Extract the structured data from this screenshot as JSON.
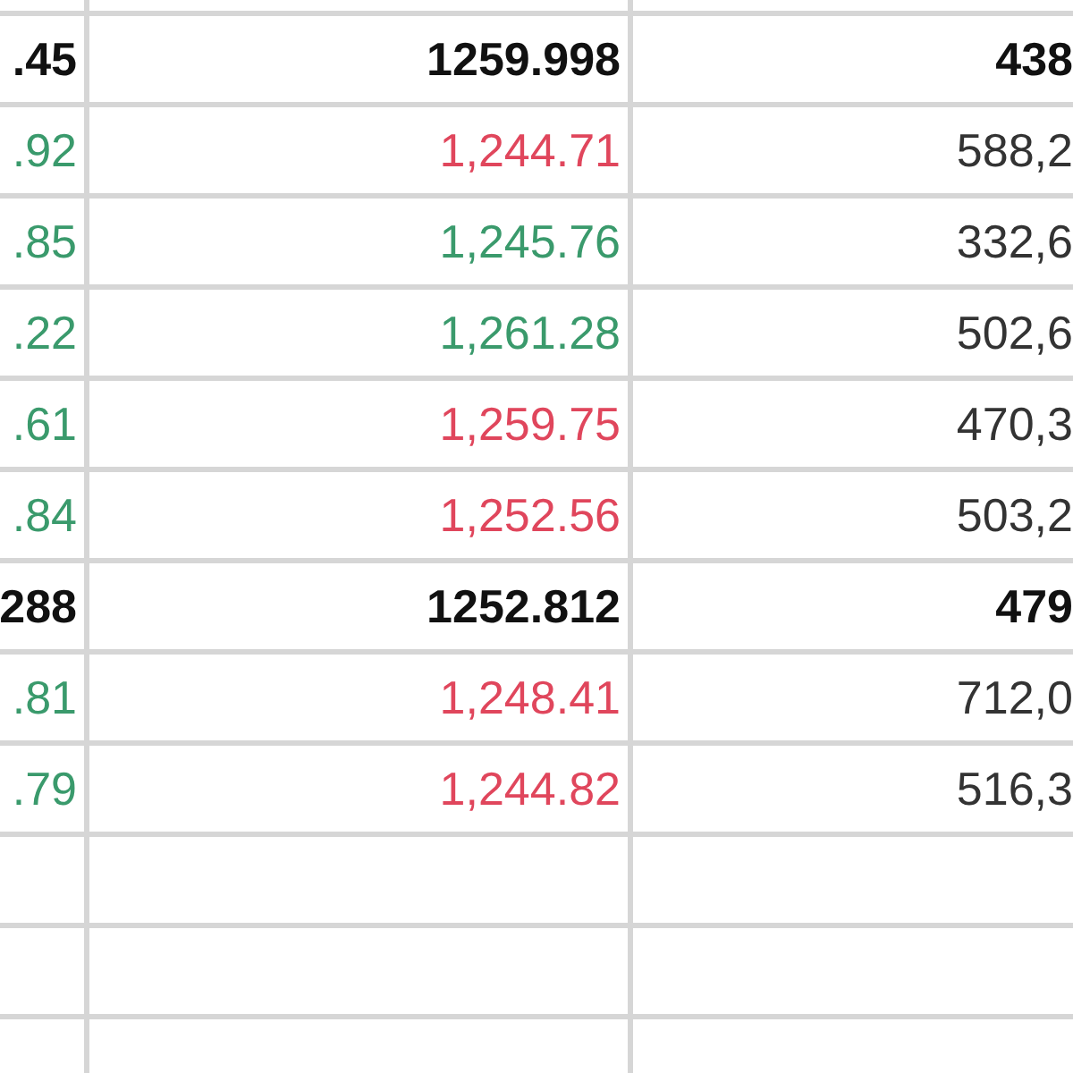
{
  "rows": [
    {
      "cells": [
        {
          "text": ".45",
          "kind": "total"
        },
        {
          "text": "1259.998",
          "kind": "total"
        },
        {
          "text": "438",
          "kind": "total"
        }
      ]
    },
    {
      "cells": [
        {
          "text": ".92",
          "kind": "up"
        },
        {
          "text": "1,244.71",
          "kind": "down"
        },
        {
          "text": "588,2",
          "kind": "plain"
        }
      ]
    },
    {
      "cells": [
        {
          "text": ".85",
          "kind": "up"
        },
        {
          "text": "1,245.76",
          "kind": "up"
        },
        {
          "text": "332,6",
          "kind": "plain"
        }
      ]
    },
    {
      "cells": [
        {
          "text": ".22",
          "kind": "up"
        },
        {
          "text": "1,261.28",
          "kind": "up"
        },
        {
          "text": "502,6",
          "kind": "plain"
        }
      ]
    },
    {
      "cells": [
        {
          "text": ".61",
          "kind": "up"
        },
        {
          "text": "1,259.75",
          "kind": "down"
        },
        {
          "text": "470,3",
          "kind": "plain"
        }
      ]
    },
    {
      "cells": [
        {
          "text": ".84",
          "kind": "up"
        },
        {
          "text": "1,252.56",
          "kind": "down"
        },
        {
          "text": "503,2",
          "kind": "plain"
        }
      ]
    },
    {
      "cells": [
        {
          "text": "288",
          "kind": "total"
        },
        {
          "text": "1252.812",
          "kind": "total"
        },
        {
          "text": "479",
          "kind": "total"
        }
      ]
    },
    {
      "cells": [
        {
          "text": ".81",
          "kind": "up"
        },
        {
          "text": "1,248.41",
          "kind": "down"
        },
        {
          "text": "712,0",
          "kind": "plain"
        }
      ]
    },
    {
      "cells": [
        {
          "text": ".79",
          "kind": "up"
        },
        {
          "text": "1,244.82",
          "kind": "down"
        },
        {
          "text": "516,3",
          "kind": "plain"
        }
      ]
    }
  ]
}
